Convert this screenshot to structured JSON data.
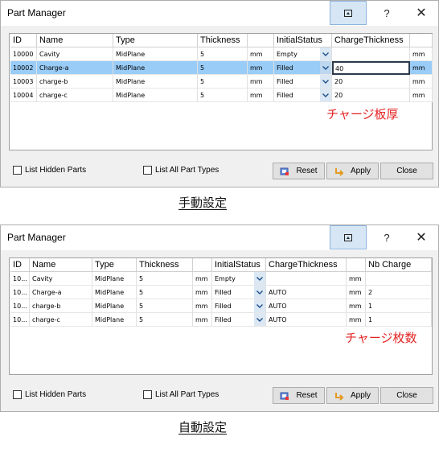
{
  "windows": [
    {
      "title": "Part Manager",
      "controls": {
        "help": "?",
        "close": "✕"
      },
      "columns": [
        {
          "label": "ID",
          "w": 33
        },
        {
          "label": "Name",
          "w": 95
        },
        {
          "label": "Type",
          "w": 105
        },
        {
          "label": "Thickness",
          "w": 62
        },
        {
          "label": "",
          "w": 33
        },
        {
          "label": "InitialStatus",
          "w": 72
        },
        {
          "label": "ChargeThickness",
          "w": 97
        },
        {
          "label": "",
          "w": 28
        }
      ],
      "rows": [
        {
          "cells": [
            "10000",
            "Cavity",
            "MidPlane",
            "5",
            "mm",
            "Empty",
            "",
            "mm"
          ],
          "selected": false
        },
        {
          "cells": [
            "10002",
            "Charge-a",
            "MidPlane",
            "5",
            "mm",
            "Filled",
            "40",
            "mm"
          ],
          "selected": true
        },
        {
          "cells": [
            "10003",
            "charge-b",
            "MidPlane",
            "5",
            "mm",
            "Filled",
            "20",
            "mm"
          ],
          "selected": false
        },
        {
          "cells": [
            "10004",
            "charge-c",
            "MidPlane",
            "5",
            "mm",
            "Filled",
            "20",
            "mm"
          ],
          "selected": false
        }
      ],
      "annotation": "チャージ板厚",
      "list_hidden": "List Hidden Parts",
      "list_all": "List All Part Types",
      "reset": "Reset",
      "apply": "Apply",
      "close": "Close",
      "caption": "手動設定"
    },
    {
      "title": "Part Manager",
      "controls": {
        "help": "?",
        "close": "✕"
      },
      "columns": [
        {
          "label": "ID",
          "w": 24
        },
        {
          "label": "Name",
          "w": 78
        },
        {
          "label": "Type",
          "w": 55
        },
        {
          "label": "Thickness",
          "w": 70
        },
        {
          "label": "",
          "w": 24
        },
        {
          "label": "InitialStatus",
          "w": 67
        },
        {
          "label": "ChargeThickness",
          "w": 100
        },
        {
          "label": "",
          "w": 24
        },
        {
          "label": "Nb Charge",
          "w": 82
        }
      ],
      "rows": [
        {
          "cells": [
            "10...",
            "Cavity",
            "MidPlane",
            "5",
            "mm",
            "Empty",
            "",
            "mm",
            ""
          ],
          "selected": false
        },
        {
          "cells": [
            "10...",
            "Charge-a",
            "MidPlane",
            "5",
            "mm",
            "Filled",
            "AUTO",
            "mm",
            "2"
          ],
          "selected": false
        },
        {
          "cells": [
            "10...",
            "charge-b",
            "MidPlane",
            "5",
            "mm",
            "Filled",
            "AUTO",
            "mm",
            "1"
          ],
          "selected": false
        },
        {
          "cells": [
            "10...",
            "charge-c",
            "MidPlane",
            "5",
            "mm",
            "Filled",
            "AUTO",
            "mm",
            "1"
          ],
          "selected": false
        }
      ],
      "annotation": "チャージ枚数",
      "list_hidden": "List Hidden Parts",
      "list_all": "List All Part Types",
      "reset": "Reset",
      "apply": "Apply",
      "close": "Close",
      "caption": "自動設定"
    }
  ]
}
